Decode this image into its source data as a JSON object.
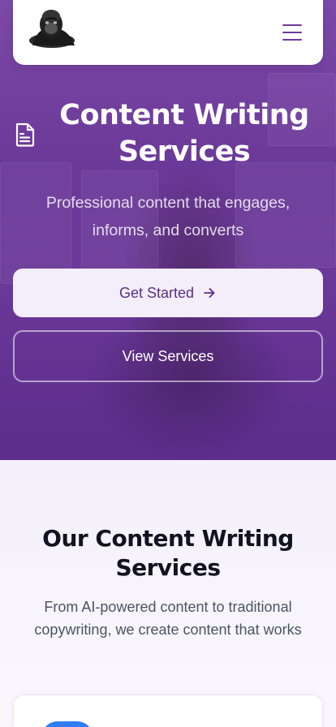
{
  "nav": {
    "logo_icon": "gorilla-logo",
    "menu_icon": "hamburger-menu-icon",
    "brand_color": "#6b3a9a"
  },
  "hero": {
    "icon": "document-icon",
    "title": "Content Writing Services",
    "subtitle": "Professional content that engages, informs, and converts",
    "primary_button": "Get Started",
    "primary_button_icon": "arrow-right-icon",
    "secondary_button": "View Services",
    "overlay_color": "#6d3b9a"
  },
  "services": {
    "title": "Our Content Writing Services",
    "subtitle": "From AI-powered content to traditional copywriting, we create content that works",
    "card_icon_color": "#2f7df0"
  }
}
